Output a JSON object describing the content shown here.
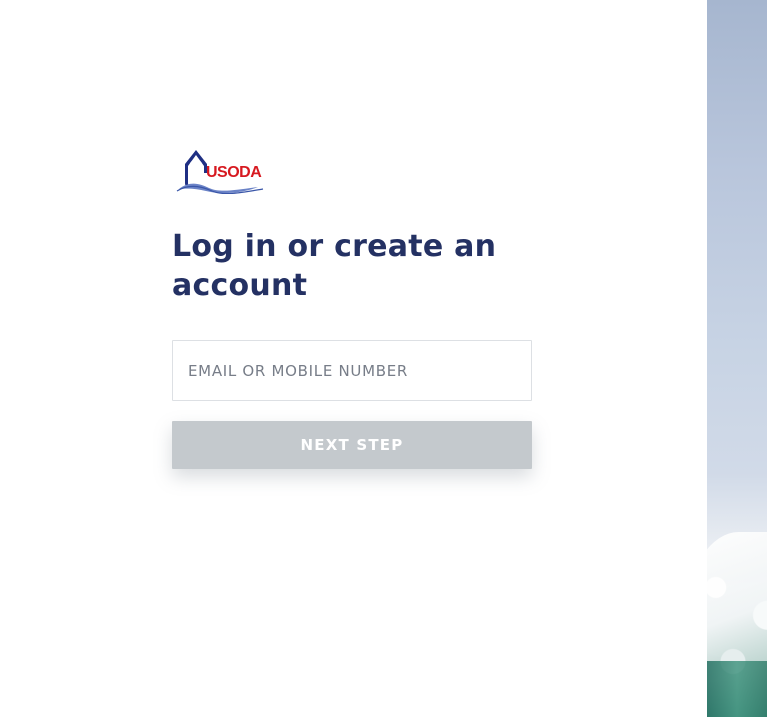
{
  "brand": {
    "logo_text": "USODA",
    "colors": {
      "logo_blue": "#1f2f83",
      "logo_red": "#d71920",
      "title": "#243163",
      "button_disabled": "#c4c9cd"
    }
  },
  "login": {
    "title": "Log in or create an account",
    "email_placeholder": "EMAIL OR MOBILE NUMBER",
    "email_value": "",
    "next_button_label": "NEXT STEP"
  },
  "icons": {
    "logo": "usoda-logo-icon"
  }
}
